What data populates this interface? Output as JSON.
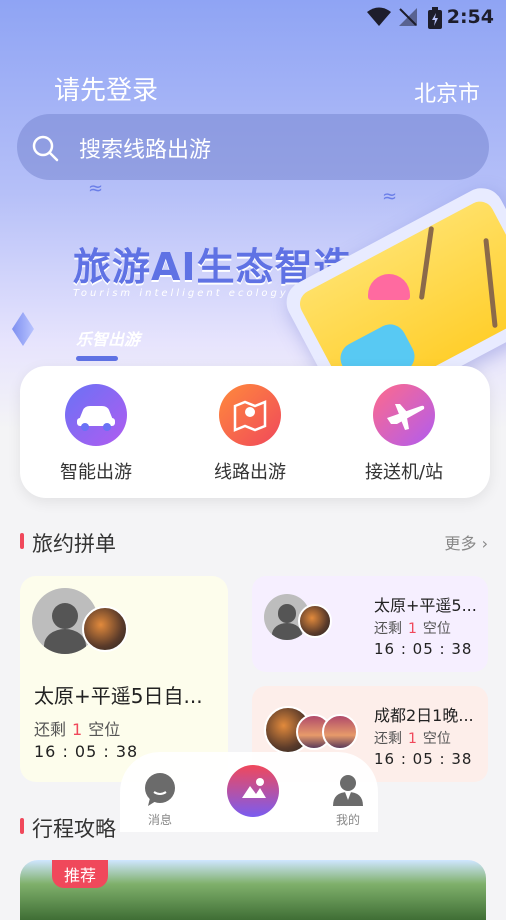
{
  "status_bar": {
    "time": "2:54"
  },
  "header": {
    "login_text": "请先登录",
    "city": "北京市"
  },
  "search": {
    "placeholder": "搜索线路出游"
  },
  "banner": {
    "title": "旅游AI生态智造",
    "subtitle": "Tourism intelligent ecology",
    "tag": "乐智出游"
  },
  "menu": [
    {
      "label": "智能出游",
      "icon": "car-icon"
    },
    {
      "label": "线路出游",
      "icon": "map-pin-icon"
    },
    {
      "label": "接送机/站",
      "icon": "airplane-icon"
    }
  ],
  "sections": {
    "group_trips": {
      "title": "旅约拼单",
      "more": "更多 ›"
    },
    "guides": {
      "title": "行程攻略"
    }
  },
  "trips": [
    {
      "title": "太原+平遥5日自...",
      "seats_prefix": "还剩",
      "seats": "1",
      "seats_suffix": "空位",
      "time": "16 : 05 : 38"
    },
    {
      "title": "太原+平遥5...",
      "seats_prefix": "还剩",
      "seats": "1",
      "seats_suffix": "空位",
      "time": "16 : 05 : 38"
    },
    {
      "title": "成都2日1晚...",
      "seats_prefix": "还剩",
      "seats": "1",
      "seats_suffix": "空位",
      "time": "16 : 05 : 38"
    }
  ],
  "bottom_nav": [
    {
      "label": "消息",
      "icon": "message-icon"
    },
    {
      "label": "",
      "icon": "home-travel-icon"
    },
    {
      "label": "我的",
      "icon": "user-icon"
    }
  ],
  "guide_card": {
    "tag": "推荐"
  },
  "colors": {
    "accent": "#f0485b",
    "primary": "#5f72e4"
  }
}
